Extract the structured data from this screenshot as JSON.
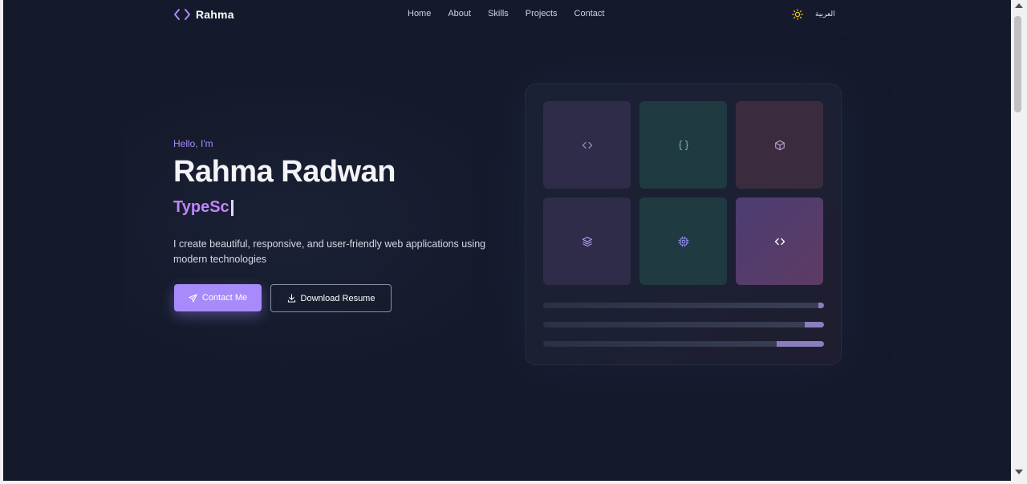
{
  "nav": {
    "logo_text": "Rahma",
    "links": [
      "Home",
      "About",
      "Skills",
      "Projects",
      "Contact"
    ],
    "language_label": "العربية",
    "theme_icon": "sun-icon"
  },
  "hero": {
    "greeting": "Hello, I'm",
    "name": "Rahma Radwan",
    "typed_text": "TypeSc",
    "description": "I create beautiful, responsive, and user-friendly web applications using modern technologies",
    "contact_button": "Contact Me",
    "resume_button": "Download Resume"
  },
  "illustration": {
    "tile_icons": [
      "code-icon",
      "braces-icon",
      "cube-icon",
      "layers-icon",
      "cpu-icon",
      "code-icon"
    ],
    "bar_fill_fractions": [
      0.02,
      0.07,
      0.17
    ]
  },
  "colors": {
    "background": "#141a2b",
    "accent": "#a78bfa",
    "accent_text": "#c084fc",
    "sun": "#f5c518"
  }
}
